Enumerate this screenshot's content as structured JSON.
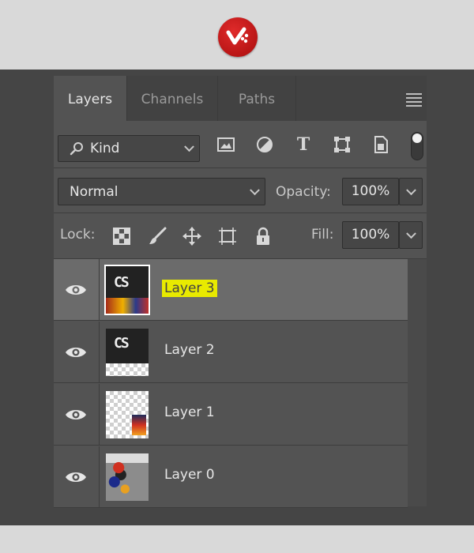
{
  "tabs": [
    {
      "label": "Layers",
      "active": true
    },
    {
      "label": "Channels",
      "active": false
    },
    {
      "label": "Paths",
      "active": false
    }
  ],
  "filter": {
    "kind_label": "Kind",
    "icons": [
      "image-filter-icon",
      "adjustment-filter-icon",
      "type-filter-icon",
      "shape-filter-icon",
      "smart-object-filter-icon"
    ]
  },
  "blend": {
    "mode": "Normal",
    "opacity_label": "Opacity:",
    "opacity_value": "100%"
  },
  "lock": {
    "label": "Lock:",
    "icons": [
      "lock-transparent-pixels-icon",
      "lock-image-pixels-icon",
      "lock-position-icon",
      "lock-artboard-icon",
      "lock-all-icon"
    ],
    "fill_label": "Fill:",
    "fill_value": "100%"
  },
  "layers": [
    {
      "name": "Layer 3",
      "selected": true,
      "highlighted": true,
      "visible": true
    },
    {
      "name": "Layer 2",
      "selected": false,
      "highlighted": false,
      "visible": true
    },
    {
      "name": "Layer 1",
      "selected": false,
      "highlighted": false,
      "visible": true
    },
    {
      "name": "Layer 0",
      "selected": false,
      "highlighted": false,
      "visible": true
    }
  ],
  "colors": {
    "panel_bg": "#535353",
    "selected_row": "#6b6b6b",
    "highlight": "#e8ea00",
    "logo_red": "#d21f1f"
  }
}
